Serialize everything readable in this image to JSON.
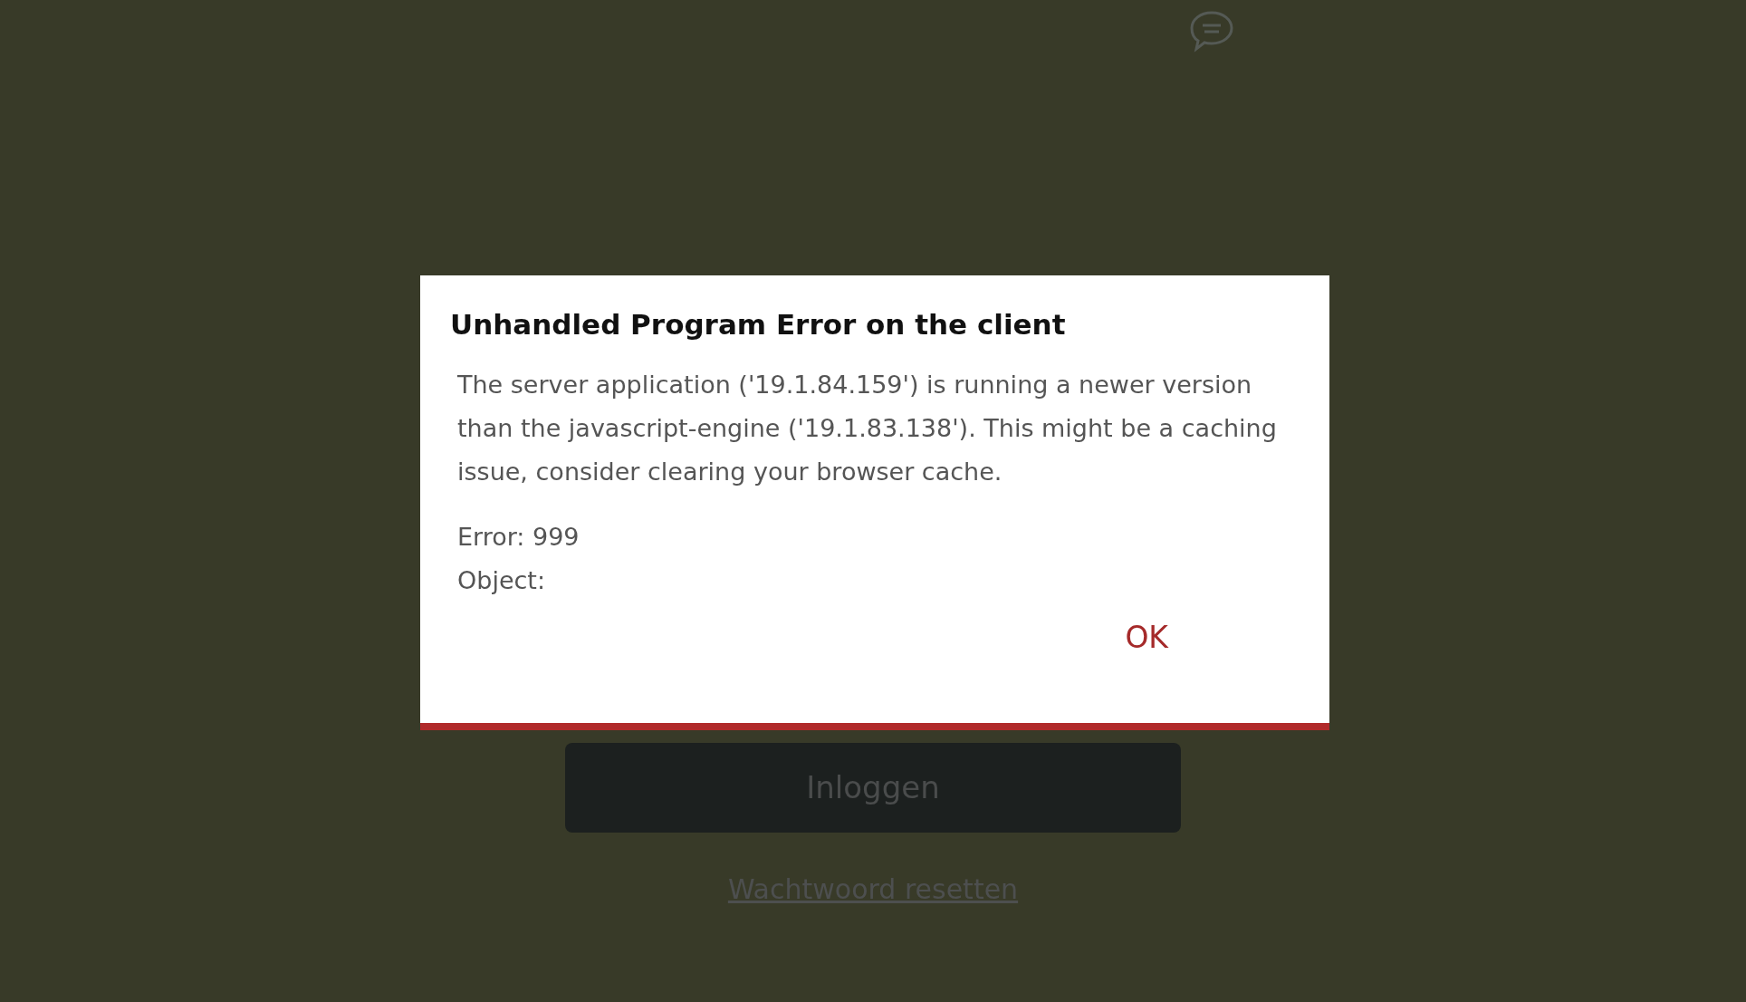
{
  "dialog": {
    "title": "Unhandled Program Error on the client",
    "message": "The server application ('19.1.84.159') is running a newer version than the javascript-engine ('19.1.83.138'). This might be a caching issue, consider clearing your browser cache.",
    "details": [
      "Error: 999",
      "Object:"
    ],
    "button": "OK"
  },
  "login": {
    "button": "Inloggen",
    "reset_link": "Wachtwoord resetten"
  }
}
